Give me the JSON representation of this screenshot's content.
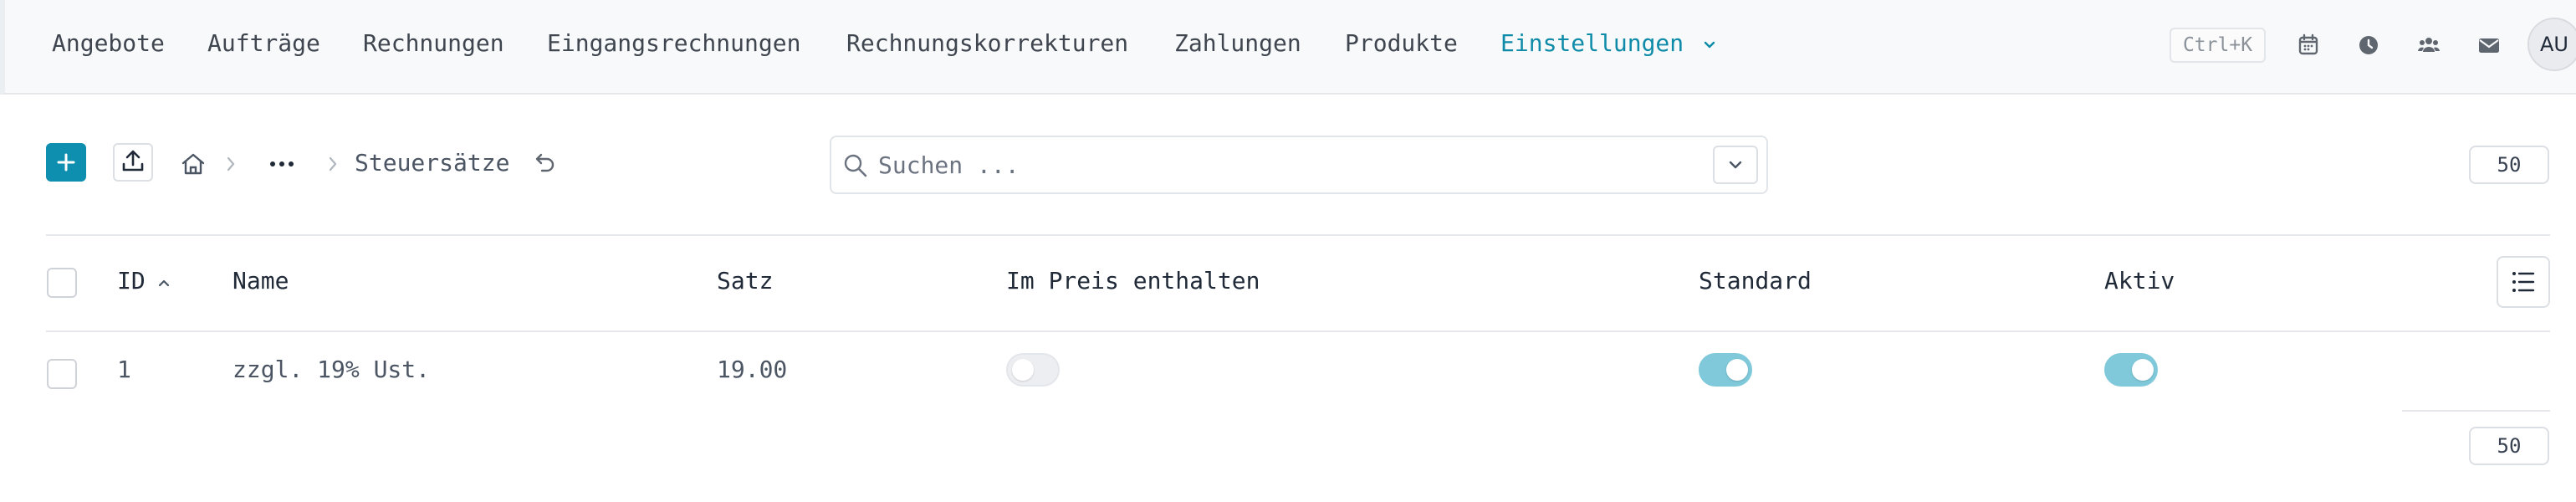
{
  "nav": {
    "items": [
      {
        "label": "Angebote"
      },
      {
        "label": "Aufträge"
      },
      {
        "label": "Rechnungen"
      },
      {
        "label": "Eingangsrechnungen"
      },
      {
        "label": "Rechnungskorrekturen"
      },
      {
        "label": "Zahlungen"
      },
      {
        "label": "Produkte"
      },
      {
        "label": "Einstellungen",
        "active": true
      }
    ],
    "shortcut": "Ctrl+K",
    "icons": [
      "calendar-icon",
      "clock-icon",
      "users-icon",
      "mail-icon"
    ],
    "avatar_initials": "AU"
  },
  "toolbar": {
    "add_icon": "plus-icon",
    "upload_icon": "upload-icon",
    "breadcrumb": {
      "home_icon": "home-icon",
      "more_icon": "ellipsis-icon",
      "current": "Steuersätze",
      "reset_icon": "undo-icon"
    },
    "search": {
      "placeholder": "Suchen ..."
    },
    "page_size": "50"
  },
  "table": {
    "columns": [
      "ID",
      "Name",
      "Satz",
      "Im Preis enthalten",
      "Standard",
      "Aktiv"
    ],
    "sort_column": "ID",
    "sort_direction": "asc",
    "rows": [
      {
        "id": "1",
        "name": "zzgl. 19% Ust.",
        "satz": "19.00",
        "im_preis_enthalten": false,
        "standard": true,
        "aktiv": true
      }
    ],
    "footer_page_size": "50"
  },
  "colors": {
    "accent": "#0e8ba8",
    "toggle_on": "#7fc9da",
    "toggle_off": "#eceef1"
  }
}
